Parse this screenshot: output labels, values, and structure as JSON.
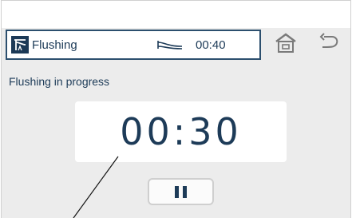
{
  "header": {
    "title": "Flushing",
    "remaining_time": "00:40"
  },
  "main": {
    "status_text": "Flushing in progress",
    "countdown": "00:30"
  },
  "icons": {
    "title_icon": "flushing-icon",
    "flow_icon": "flow-icon",
    "home_icon": "home-icon",
    "back_icon": "back-icon",
    "pause_icon": "pause-icon"
  },
  "colors": {
    "accent": "#1d3b58",
    "border": "#2c4f6e",
    "background": "#ececec"
  }
}
